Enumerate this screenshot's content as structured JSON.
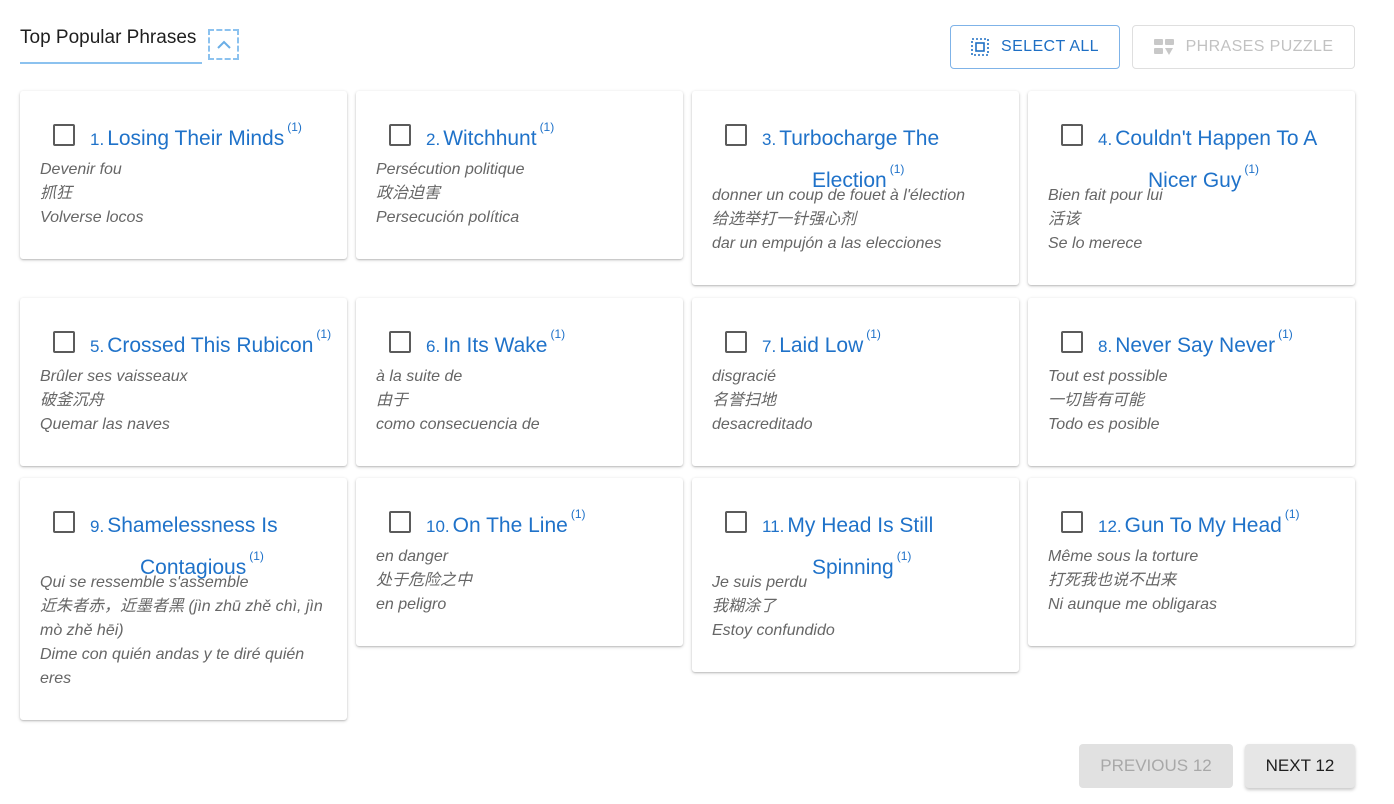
{
  "header": {
    "title": "Top Popular Phrases"
  },
  "toolbar": {
    "select_all": "SELECT ALL",
    "phrases_puzzle": "PHRASES PUZZLE"
  },
  "phrases": [
    {
      "num": "1.",
      "title": "Losing Their Minds",
      "count": "(1)",
      "fr": "Devenir fou",
      "zh": "抓狂",
      "es": "Volverse locos"
    },
    {
      "num": "2.",
      "title": "Witchhunt",
      "count": "(1)",
      "fr": "Persécution politique",
      "zh": "政治迫害",
      "es": "Persecución política"
    },
    {
      "num": "3.",
      "title": "Turbocharge The Election",
      "count": "(1)",
      "fr": "donner un coup de fouet à l'élection",
      "zh": "给选举打一针强心剂",
      "es": "dar un empujón a las elecciones"
    },
    {
      "num": "4.",
      "title": "Couldn't Happen To A Nicer Guy",
      "count": "(1)",
      "fr": "Bien fait pour lui",
      "zh": "活该",
      "es": "Se lo merece"
    },
    {
      "num": "5.",
      "title": "Crossed This Rubicon",
      "count": "(1)",
      "fr": "Brûler ses vaisseaux",
      "zh": "破釜沉舟",
      "es": "Quemar las naves"
    },
    {
      "num": "6.",
      "title": "In Its Wake",
      "count": "(1)",
      "fr": "à la suite de",
      "zh": "由于",
      "es": "como consecuencia de"
    },
    {
      "num": "7.",
      "title": "Laid Low",
      "count": "(1)",
      "fr": "disgracié",
      "zh": "名誉扫地",
      "es": "desacreditado"
    },
    {
      "num": "8.",
      "title": "Never Say Never",
      "count": "(1)",
      "fr": "Tout est possible",
      "zh": "一切皆有可能",
      "es": "Todo es posible"
    },
    {
      "num": "9.",
      "title": "Shamelessness Is Contagious",
      "count": "(1)",
      "fr": "Qui se ressemble s'assemble",
      "zh": "近朱者赤，近墨者黑 (jìn zhū zhě chì, jìn mò zhě hēi)",
      "es": "Dime con quién andas y te diré quién eres"
    },
    {
      "num": "10.",
      "title": "On The Line",
      "count": "(1)",
      "fr": "en danger",
      "zh": "处于危险之中",
      "es": "en peligro"
    },
    {
      "num": "11.",
      "title": "My Head Is Still Spinning",
      "count": "(1)",
      "fr": "Je suis perdu",
      "zh": "我糊涂了",
      "es": "Estoy confundido"
    },
    {
      "num": "12.",
      "title": "Gun To My Head",
      "count": "(1)",
      "fr": "Même sous la torture",
      "zh": "打死我也说不出来",
      "es": "Ni aunque me obligaras"
    }
  ],
  "pagination": {
    "previous": "PREVIOUS 12",
    "next": "NEXT 12"
  }
}
